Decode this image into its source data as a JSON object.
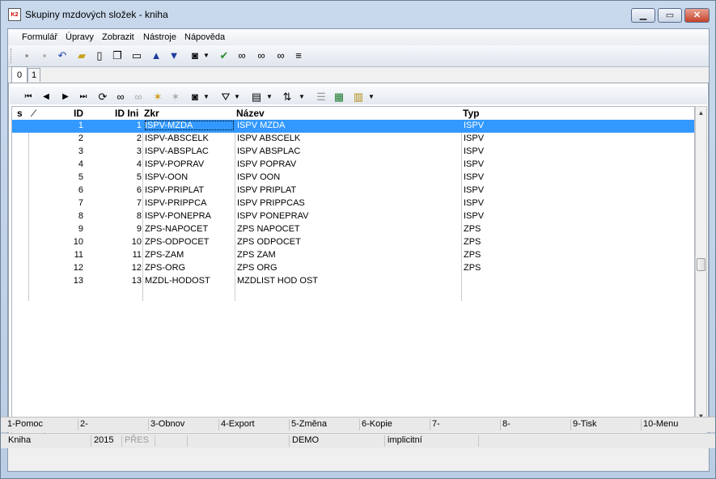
{
  "window": {
    "title": "Skupiny mzdových složek - kniha",
    "app_icon_text": "K2"
  },
  "menu": [
    "Formulář",
    "Úpravy",
    "Zobrazit",
    "Nástroje",
    "Nápověda"
  ],
  "tabs": [
    "0",
    "1"
  ],
  "columns": {
    "s": "s",
    "sort": "⁄",
    "id": "ID",
    "id_ini": "ID Ini",
    "zkr": "Zkr",
    "nazev": "Název",
    "typ": "Typ"
  },
  "rows": [
    {
      "id": "1",
      "id_ini": "1",
      "zkr": "ISPV-MZDA",
      "nazev": "ISPV MZDA",
      "typ": "ISPV"
    },
    {
      "id": "2",
      "id_ini": "2",
      "zkr": "ISPV-ABSCELK",
      "nazev": "ISPV ABSCELK",
      "typ": "ISPV"
    },
    {
      "id": "3",
      "id_ini": "3",
      "zkr": "ISPV-ABSPLAC",
      "nazev": "ISPV ABSPLAC",
      "typ": "ISPV"
    },
    {
      "id": "4",
      "id_ini": "4",
      "zkr": "ISPV-POPRAV",
      "nazev": "ISPV POPRAV",
      "typ": "ISPV"
    },
    {
      "id": "5",
      "id_ini": "5",
      "zkr": "ISPV-OON",
      "nazev": "ISPV OON",
      "typ": "ISPV"
    },
    {
      "id": "6",
      "id_ini": "6",
      "zkr": "ISPV-PRIPLAT",
      "nazev": "ISPV PRIPLAT",
      "typ": "ISPV"
    },
    {
      "id": "7",
      "id_ini": "7",
      "zkr": "ISPV-PRIPPCA",
      "nazev": "ISPV PRIPPCAS",
      "typ": "ISPV"
    },
    {
      "id": "8",
      "id_ini": "8",
      "zkr": "ISPV-PONEPRA",
      "nazev": "ISPV PONEPRAV",
      "typ": "ISPV"
    },
    {
      "id": "9",
      "id_ini": "9",
      "zkr": "ZPS-NAPOCET",
      "nazev": "ZPS NAPOCET",
      "typ": "ZPS"
    },
    {
      "id": "10",
      "id_ini": "10",
      "zkr": "ZPS-ODPOCET",
      "nazev": "ZPS ODPOCET",
      "typ": "ZPS"
    },
    {
      "id": "11",
      "id_ini": "11",
      "zkr": "ZPS-ZAM",
      "nazev": "ZPS ZAM",
      "typ": "ZPS"
    },
    {
      "id": "12",
      "id_ini": "12",
      "zkr": "ZPS-ORG",
      "nazev": "ZPS ORG",
      "typ": "ZPS"
    },
    {
      "id": "13",
      "id_ini": "13",
      "zkr": "MZDL-HODOST",
      "nazev": "MZDLIST HOD OST",
      "typ": ""
    }
  ],
  "selected_row": 1,
  "function_keys": [
    "1-Pomoc",
    "2-",
    "3-Obnov",
    "4-Export",
    "5-Změna",
    "6-Kopie",
    "7-",
    "8-",
    "9-Tisk",
    "10-Menu"
  ],
  "status": {
    "book": "Kniha",
    "year": "2015",
    "mode": "PŘES",
    "db": "DEMO",
    "view": "implicitní"
  },
  "colors": {
    "selection": "#3399ff",
    "title_gradient": "#c9d9ec",
    "close_button": "#c6422a"
  },
  "icons": {
    "main_toolbar": [
      "save-icon",
      "save-disabled-icon",
      "undo-icon",
      "open-folder-icon",
      "new-document-icon",
      "copy-icon",
      "book-icon",
      "arrow-up-icon",
      "arrow-down-icon",
      "camera-icon",
      "dropdown-arrow-icon",
      "green-tick-binoculars-icon",
      "binoculars-icon",
      "binoculars-filter-icon",
      "binoculars-star-icon",
      "menu-lines-icon"
    ],
    "nav_toolbar": [
      "first-record-icon",
      "prev-record-icon",
      "next-record-icon",
      "last-record-icon",
      "refresh-icon",
      "binoculars-icon",
      "binoculars-disabled-icon",
      "star-add-icon",
      "star-remove-icon",
      "camera-icon",
      "dropdown-arrow-icon",
      "filter-icon",
      "dropdown-arrow-icon",
      "columns-icon",
      "dropdown-arrow-icon",
      "sort-az-icon",
      "dropdown-arrow-icon",
      "list-icon",
      "excel-export-icon",
      "report-icon",
      "dropdown-arrow-icon"
    ]
  }
}
